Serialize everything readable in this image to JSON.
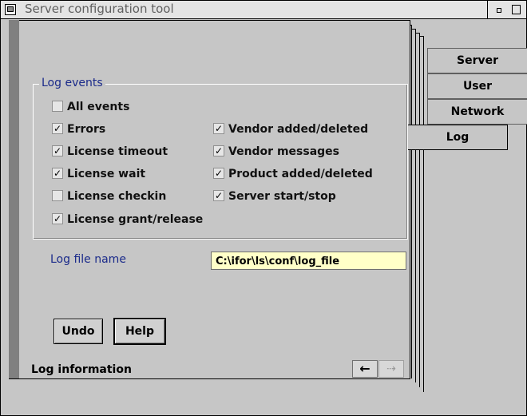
{
  "window": {
    "title": "Server configuration tool"
  },
  "tabs": [
    {
      "label": "Server",
      "active": false
    },
    {
      "label": "User",
      "active": false
    },
    {
      "label": "Network",
      "active": false
    },
    {
      "label": "Log",
      "active": true
    }
  ],
  "log_events": {
    "group_title": "Log events",
    "items": [
      {
        "label": "All events",
        "checked": false
      },
      {
        "label": "Errors",
        "checked": true
      },
      {
        "label": "License timeout",
        "checked": true
      },
      {
        "label": "License wait",
        "checked": true
      },
      {
        "label": "License checkin",
        "checked": false
      },
      {
        "label": "License grant/release",
        "checked": true
      },
      {
        "label": "Vendor added/deleted",
        "checked": true
      },
      {
        "label": "Vendor messages",
        "checked": true
      },
      {
        "label": "Product added/deleted",
        "checked": true
      },
      {
        "label": "Server start/stop",
        "checked": true
      }
    ]
  },
  "log_file": {
    "label": "Log file name",
    "value": "C:\\ifor\\ls\\conf\\log_file"
  },
  "buttons": {
    "undo": "Undo",
    "help": "Help"
  },
  "status": {
    "text": "Log information"
  },
  "arrows": {
    "left": "←",
    "right": "⇢"
  }
}
